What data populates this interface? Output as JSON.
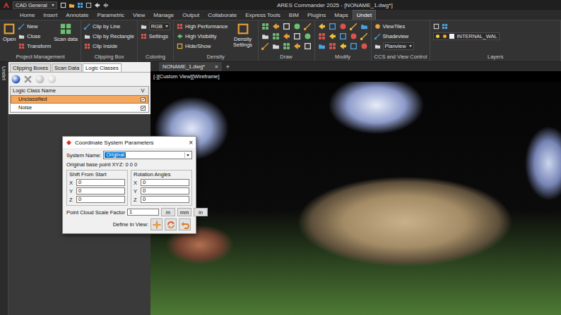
{
  "window": {
    "title": "ARES Commander 2025 - [NONAME_1.dwg*]",
    "workspace": "CAD General"
  },
  "menu_tabs": [
    {
      "label": "Home",
      "selected": false
    },
    {
      "label": "Insert",
      "selected": false
    },
    {
      "label": "Annotate",
      "selected": false
    },
    {
      "label": "Parametric",
      "selected": false
    },
    {
      "label": "View",
      "selected": false
    },
    {
      "label": "Manage",
      "selected": false
    },
    {
      "label": "Output",
      "selected": false
    },
    {
      "label": "Collaborate",
      "selected": false
    },
    {
      "label": "Express Tools",
      "selected": false
    },
    {
      "label": "BIM",
      "selected": false
    },
    {
      "label": "Plugins",
      "selected": false
    },
    {
      "label": "Maps",
      "selected": false
    },
    {
      "label": "Undet",
      "selected": true
    }
  ],
  "ribbon_groups": [
    {
      "label": "Project Management",
      "kind": "buttons",
      "items": [
        {
          "label": "Open",
          "kind": "large"
        },
        {
          "label": "New",
          "kind": "small"
        },
        {
          "label": "Close",
          "kind": "small"
        },
        {
          "label": "Transform",
          "kind": "small"
        },
        {
          "label": "Scan data",
          "kind": "large"
        }
      ]
    },
    {
      "label": "Clipping Box",
      "kind": "buttons",
      "items": [
        {
          "label": "Clip by Line",
          "kind": "small"
        },
        {
          "label": "Clip by Rectangle",
          "kind": "small"
        },
        {
          "label": "Clip Inside",
          "kind": "small"
        }
      ]
    },
    {
      "label": "Coloring",
      "kind": "buttons",
      "items": [
        {
          "label": "RGB",
          "kind": "dropdown"
        },
        {
          "label": "Settings",
          "kind": "small"
        }
      ]
    },
    {
      "label": "Density",
      "kind": "buttons",
      "items": [
        {
          "label": "High Performance",
          "kind": "small"
        },
        {
          "label": "High Visibility",
          "kind": "small"
        },
        {
          "label": "Hide/Show",
          "kind": "small"
        },
        {
          "label": "Density Settings",
          "kind": "large"
        }
      ]
    },
    {
      "label": "Draw",
      "kind": "icon-grid"
    },
    {
      "label": "Modify",
      "kind": "icon-grid"
    },
    {
      "label": "CCS and View Control",
      "kind": "buttons",
      "items": [
        {
          "label": "ViewTiles",
          "kind": "small"
        },
        {
          "label": "Shadeview",
          "kind": "small"
        },
        {
          "label": "Planview",
          "kind": "dropdown"
        }
      ]
    },
    {
      "label": "Layers",
      "kind": "layers",
      "layer": "INTERNAL_WAL"
    }
  ],
  "panel": {
    "title": "Undet",
    "tabs": [
      {
        "label": "Clipping Boxes",
        "selected": false
      },
      {
        "label": "Scan Data",
        "selected": false
      },
      {
        "label": "Logic Classes",
        "selected": true
      }
    ],
    "table": {
      "columns": [
        "Logic Class Name",
        "V"
      ],
      "rows": [
        {
          "name": "Unclassified",
          "visible": true,
          "selected": true
        },
        {
          "name": "Noise",
          "visible": true,
          "selected": false
        }
      ]
    }
  },
  "viewport": {
    "tabs": [
      {
        "label": "NONAME_1.dwg*",
        "selected": true
      }
    ],
    "close": "×",
    "add": "+",
    "label": "[-][Custom View][Wireframe]"
  },
  "dialog": {
    "title": "Coordinate System Parameters",
    "close": "×",
    "system_name_label": "System Name:",
    "system_name": "Original",
    "base_point": "Original base point XYZ: 0 0 0",
    "groups": [
      {
        "label": "Shift From Start",
        "fields": [
          {
            "axis": "X",
            "value": "0"
          },
          {
            "axis": "Y",
            "value": "0"
          },
          {
            "axis": "Z",
            "value": "0"
          }
        ]
      },
      {
        "label": "Rotation Angles",
        "fields": [
          {
            "axis": "X",
            "value": "0"
          },
          {
            "axis": "Y",
            "value": "0"
          },
          {
            "axis": "Z",
            "value": "0"
          }
        ]
      }
    ],
    "scale_label": "Point Cloud Scale Factor",
    "scale": "1",
    "units": [
      "m",
      "mm",
      "in"
    ],
    "define_label": "Define In View:"
  }
}
